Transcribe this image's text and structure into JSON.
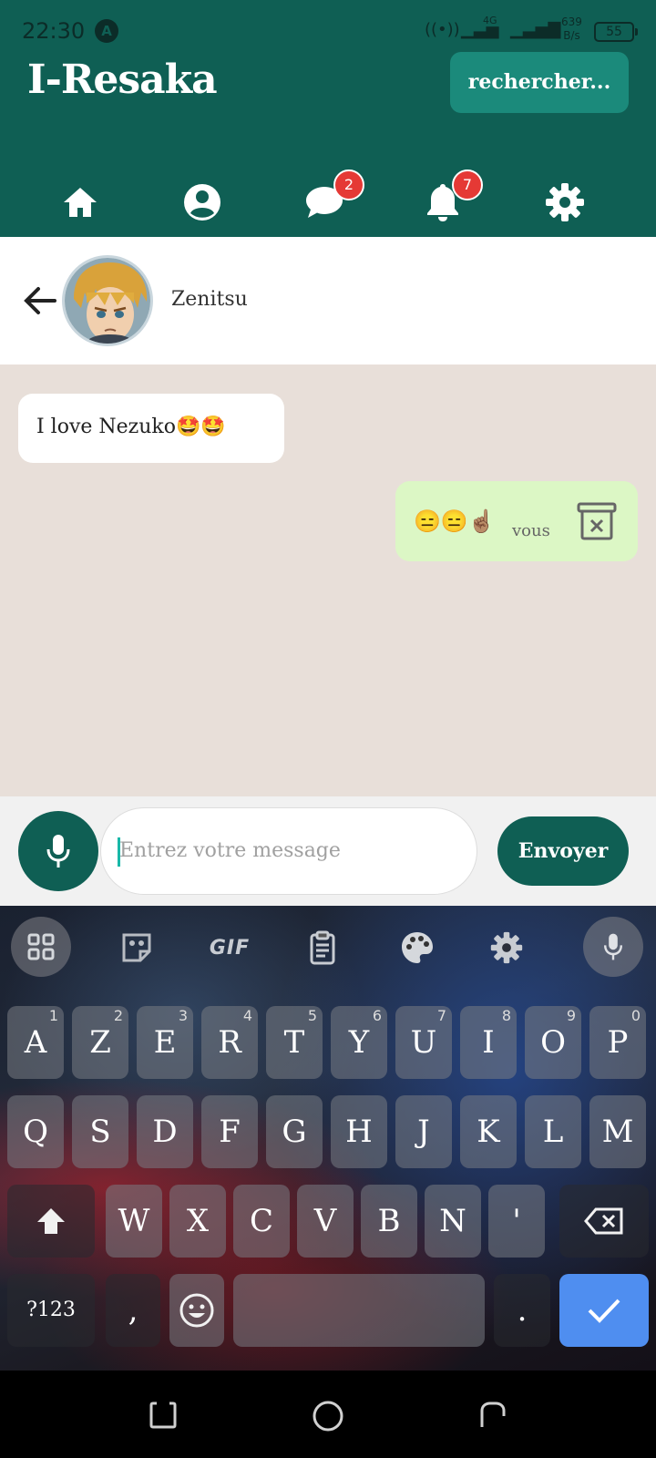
{
  "status_bar": {
    "time": "22:30",
    "app_indicator": "A",
    "signal_1": "4G",
    "speed": "639\nB/s",
    "battery": "55"
  },
  "header": {
    "app_title": "I-Resaka",
    "search_label": "rechercher..."
  },
  "nav": {
    "items": [
      {
        "icon": "home-icon"
      },
      {
        "icon": "profile-icon"
      },
      {
        "icon": "messages-icon",
        "badge": "2"
      },
      {
        "icon": "bell-icon",
        "badge": "7"
      },
      {
        "icon": "settings-icon"
      }
    ],
    "accent": "#0f5f54",
    "badge_color": "#e53935"
  },
  "chat": {
    "contact_name": "Zenitsu",
    "messages": [
      {
        "text": "I love Nezuko🤩🤩",
        "from": "other"
      },
      {
        "text": "😑😑☝🏽",
        "meta": "vous",
        "from": "me"
      }
    ]
  },
  "composer": {
    "placeholder": "Entrez votre message",
    "send_label": "Envoyer"
  },
  "keyboard": {
    "tools": {
      "gif": "GIF"
    },
    "row1": [
      {
        "k": "A",
        "n": "1"
      },
      {
        "k": "Z",
        "n": "2"
      },
      {
        "k": "E",
        "n": "3"
      },
      {
        "k": "R",
        "n": "4"
      },
      {
        "k": "T",
        "n": "5"
      },
      {
        "k": "Y",
        "n": "6"
      },
      {
        "k": "U",
        "n": "7"
      },
      {
        "k": "I",
        "n": "8"
      },
      {
        "k": "O",
        "n": "9"
      },
      {
        "k": "P",
        "n": "0"
      }
    ],
    "row2": [
      "Q",
      "S",
      "D",
      "F",
      "G",
      "H",
      "J",
      "K",
      "L",
      "M"
    ],
    "row3": [
      "W",
      "X",
      "C",
      "V",
      "B",
      "N",
      "'"
    ],
    "symbols_label": "?123",
    "comma": ",",
    "period": "."
  }
}
